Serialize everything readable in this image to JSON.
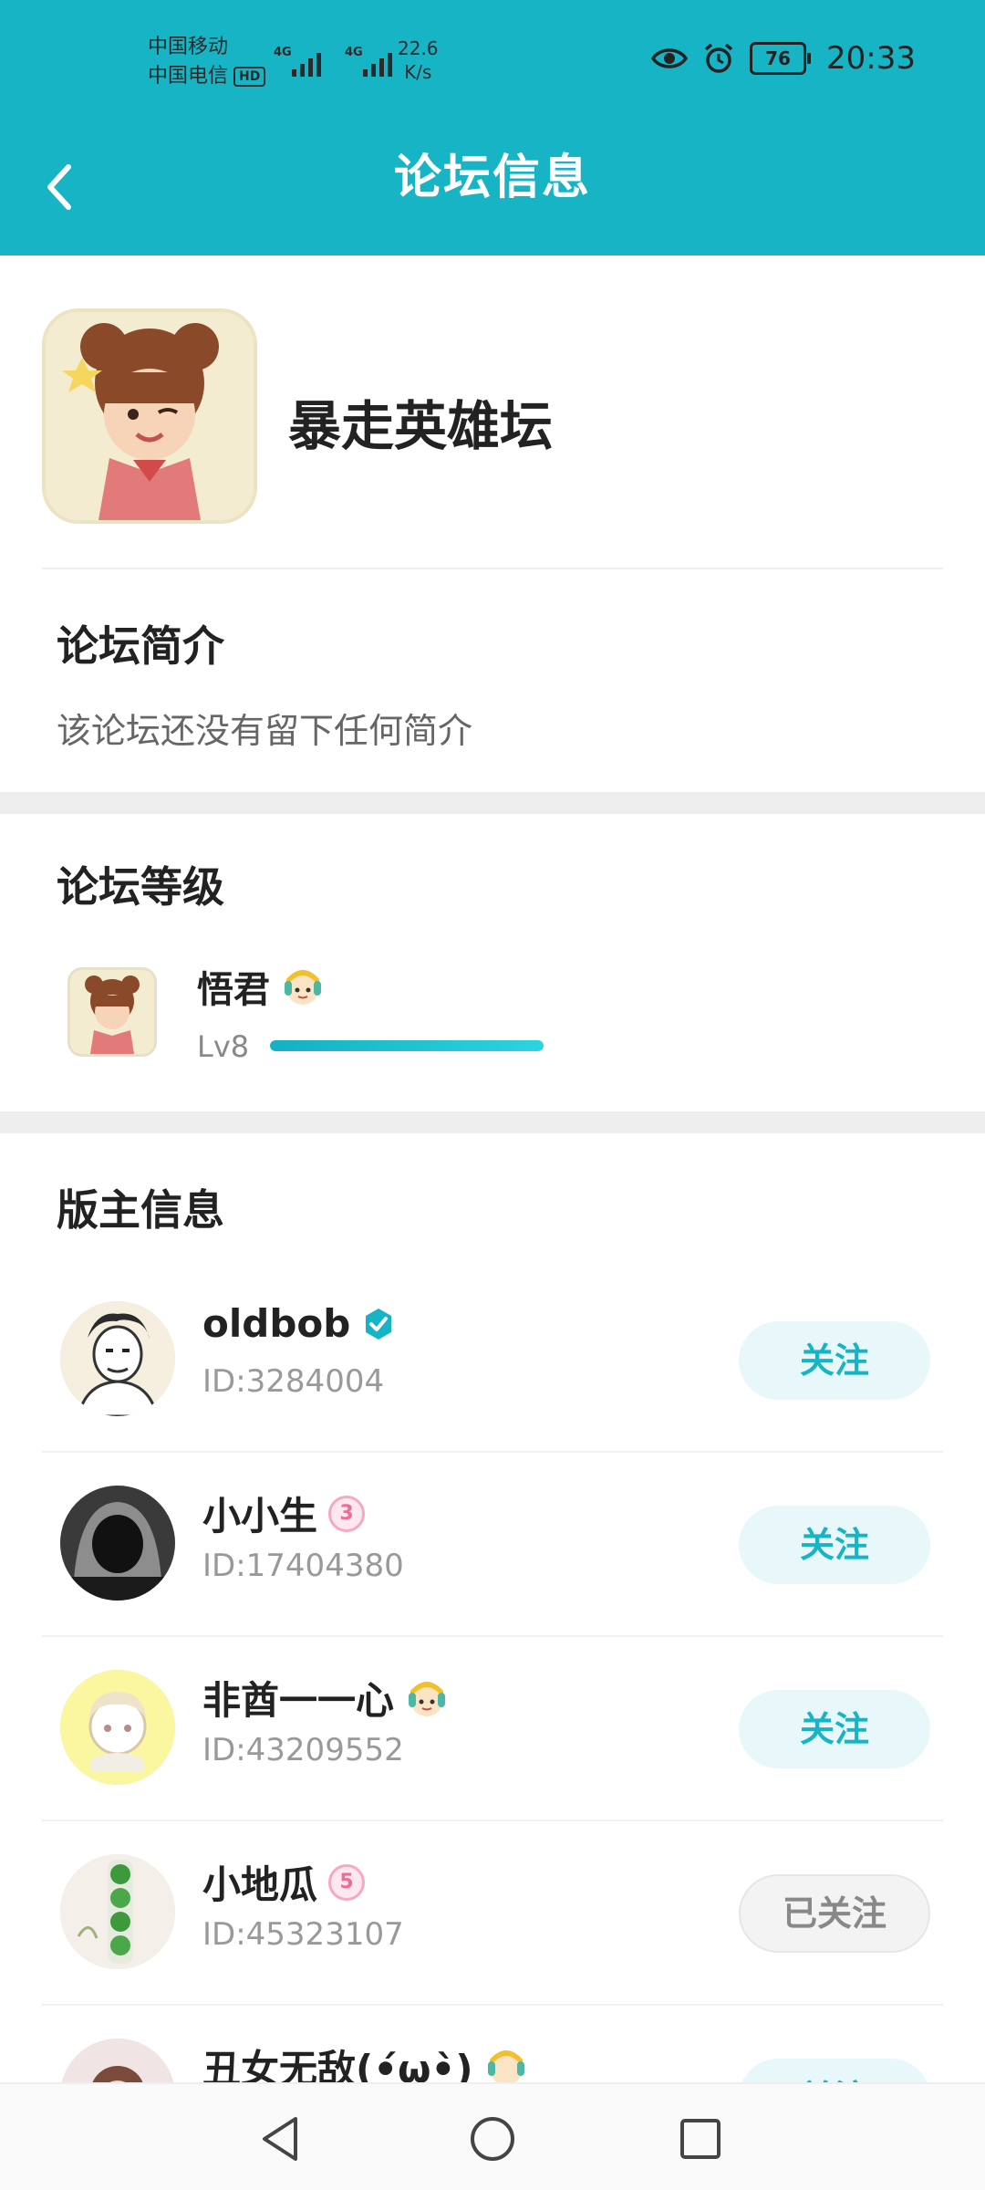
{
  "status_bar": {
    "carrier_1": "中国移动",
    "carrier_2": "中国电信",
    "hd_badge": "HD",
    "signal_1_tag": "4G",
    "signal_2_tag": "4G",
    "net_speed_value": "22.6",
    "net_speed_unit": "K/s",
    "battery": "76",
    "time": "20:33"
  },
  "header": {
    "title": "论坛信息"
  },
  "forum": {
    "name": "暴走英雄坛"
  },
  "intro": {
    "title": "论坛简介",
    "text": "该论坛还没有留下任何简介"
  },
  "level": {
    "title": "论坛等级",
    "user": "悟君",
    "level": "Lv8",
    "progress": 1.0
  },
  "moderators": {
    "title": "版主信息",
    "items": [
      {
        "name": "oldbob",
        "id": "ID:3284004",
        "button": "关注"
      },
      {
        "name": "小小生",
        "id": "ID:17404380",
        "button": "关注",
        "badge": "3"
      },
      {
        "name": "非酋一一心",
        "id": "ID:43209552",
        "button": "关注"
      },
      {
        "name": "小地瓜",
        "id": "ID:45323107",
        "button": "已关注",
        "badge": "5"
      },
      {
        "name": "丑女无敌(•́ω•̀)",
        "id": "",
        "button": "关注"
      }
    ]
  },
  "colors": {
    "accent": "#17b4c6",
    "follow_bg": "#e8f8fa",
    "followed_bg": "#f3f3f3"
  }
}
